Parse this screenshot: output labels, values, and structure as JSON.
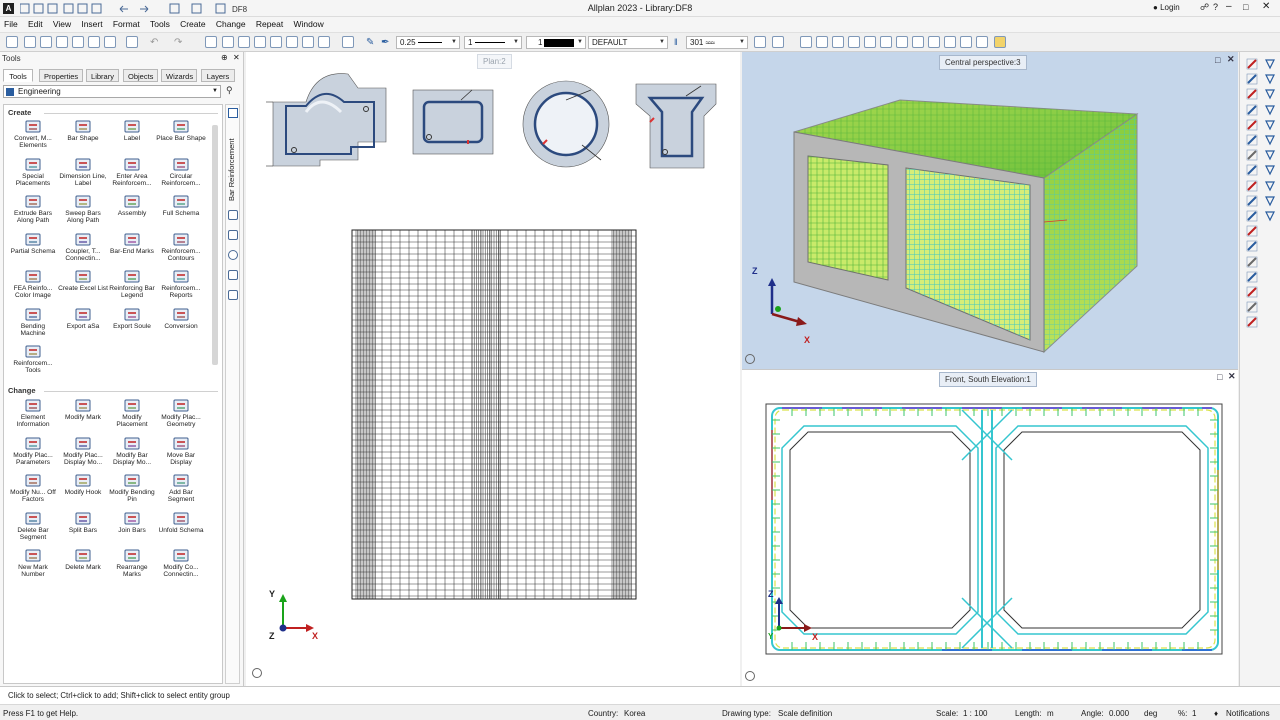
{
  "window": {
    "title": "Allplan 2023 - Library:DF8",
    "login_label": "Login"
  },
  "menu": [
    "File",
    "Edit",
    "View",
    "Insert",
    "Format",
    "Tools",
    "Create",
    "Change",
    "Repeat",
    "Window"
  ],
  "toolbar": {
    "pen_value": "0.25",
    "line_value": "1",
    "color_value": "1",
    "layer_value": "DEFAULT",
    "pattern_value": "301"
  },
  "palette": {
    "header": "Tools",
    "tabs": [
      "Tools",
      "Properties",
      "Library",
      "Objects",
      "Wizards",
      "Layers"
    ],
    "category": "Engineering",
    "vertical_tab": "Bar Reinforcement",
    "sections": {
      "create": {
        "title": "Create",
        "tools": [
          {
            "label": "Convert, M... Elements",
            "icon": "convert-elements-icon"
          },
          {
            "label": "Bar Shape",
            "icon": "bar-shape-icon"
          },
          {
            "label": "Label",
            "icon": "label-icon"
          },
          {
            "label": "Place Bar Shape",
            "icon": "place-bar-shape-icon"
          },
          {
            "label": "Special Placements",
            "icon": "special-placements-icon"
          },
          {
            "label": "Dimension Line, Label",
            "icon": "dimension-line-icon"
          },
          {
            "label": "Enter Area Reinforcem...",
            "icon": "area-reinforcement-icon"
          },
          {
            "label": "Circular Reinforcem...",
            "icon": "circular-reinforcement-icon"
          },
          {
            "label": "Extrude Bars Along Path",
            "icon": "extrude-bars-icon"
          },
          {
            "label": "Sweep Bars Along Path",
            "icon": "sweep-bars-icon"
          },
          {
            "label": "Assembly",
            "icon": "assembly-icon"
          },
          {
            "label": "Full Schema",
            "icon": "full-schema-icon"
          },
          {
            "label": "Partial Schema",
            "icon": "partial-schema-icon"
          },
          {
            "label": "Coupler, T... Connectin...",
            "icon": "coupler-icon"
          },
          {
            "label": "Bar-End Marks",
            "icon": "bar-end-marks-icon"
          },
          {
            "label": "Reinforcem... Contours",
            "icon": "reinforcement-contours-icon"
          },
          {
            "label": "FEA Reinfo... Color Image",
            "icon": "fea-color-image-icon"
          },
          {
            "label": "Create Excel List",
            "icon": "excel-list-icon"
          },
          {
            "label": "Reinforcing Bar Legend",
            "icon": "bar-legend-icon"
          },
          {
            "label": "Reinforcem... Reports",
            "icon": "reports-icon"
          },
          {
            "label": "Bending Machine",
            "icon": "bending-machine-icon"
          },
          {
            "label": "Export aSa",
            "icon": "export-asa-icon"
          },
          {
            "label": "Export Soule",
            "icon": "export-soule-icon"
          },
          {
            "label": "Conversion",
            "icon": "conversion-icon"
          },
          {
            "label": "Reinforcem... Tools",
            "icon": "reinforcement-tools-icon"
          }
        ]
      },
      "change": {
        "title": "Change",
        "tools": [
          {
            "label": "Element Information",
            "icon": "element-information-icon"
          },
          {
            "label": "Modify Mark",
            "icon": "modify-mark-icon"
          },
          {
            "label": "Modify Placement",
            "icon": "modify-placement-icon"
          },
          {
            "label": "Modify Plac... Geometry",
            "icon": "modify-placement-geometry-icon"
          },
          {
            "label": "Modify Plac... Parameters",
            "icon": "modify-placement-parameters-icon"
          },
          {
            "label": "Modify Plac... Display Mo...",
            "icon": "modify-placement-display-icon"
          },
          {
            "label": "Modify Bar Display Mo...",
            "icon": "modify-bar-display-icon"
          },
          {
            "label": "Move Bar Display",
            "icon": "move-bar-display-icon"
          },
          {
            "label": "Modify Nu... Off Factors",
            "icon": "modify-factors-icon"
          },
          {
            "label": "Modify Hook",
            "icon": "modify-hook-icon"
          },
          {
            "label": "Modify Bending Pin",
            "icon": "modify-bending-pin-icon"
          },
          {
            "label": "Add Bar Segment",
            "icon": "add-bar-segment-icon"
          },
          {
            "label": "Delete Bar Segment",
            "icon": "delete-bar-segment-icon"
          },
          {
            "label": "Split Bars",
            "icon": "split-bars-icon"
          },
          {
            "label": "Join Bars",
            "icon": "join-bars-icon"
          },
          {
            "label": "Unfold Schema",
            "icon": "unfold-schema-icon"
          },
          {
            "label": "New Mark Number",
            "icon": "new-mark-number-icon"
          },
          {
            "label": "Delete Mark",
            "icon": "delete-mark-icon"
          },
          {
            "label": "Rearrange Marks",
            "icon": "rearrange-marks-icon"
          },
          {
            "label": "Modify Co... Connectin...",
            "icon": "modify-coupler-icon"
          }
        ]
      }
    }
  },
  "viewports": {
    "plan": {
      "title": "Plan:2"
    },
    "perspective": {
      "title": "Central perspective:3"
    },
    "front": {
      "title": "Front, South Elevation:1"
    }
  },
  "axes": {
    "x": "X",
    "y": "Y",
    "z": "Z"
  },
  "colors": {
    "accent": "#2a5d9f",
    "persp_bg": "#c5d6ea",
    "rebar_green": "#6fd23a",
    "rebar_cyan": "#33d0d6",
    "concrete": "#b9b9b9"
  },
  "prompt": "Click to select; Ctrl+click to add; Shift+click to select entity group",
  "status": {
    "help": "Press F1 to get Help.",
    "country_label": "Country:",
    "country": "Korea",
    "drawing_type_label": "Drawing type:",
    "drawing_type": "Scale definition",
    "scale_label": "Scale:",
    "scale": "1 : 100",
    "length_label": "Length:",
    "length": "m",
    "angle_label": "Angle:",
    "angle": "0.000",
    "angle_unit": "deg",
    "percent_label": "%:",
    "percent": "1",
    "notifications": "Notifications"
  }
}
